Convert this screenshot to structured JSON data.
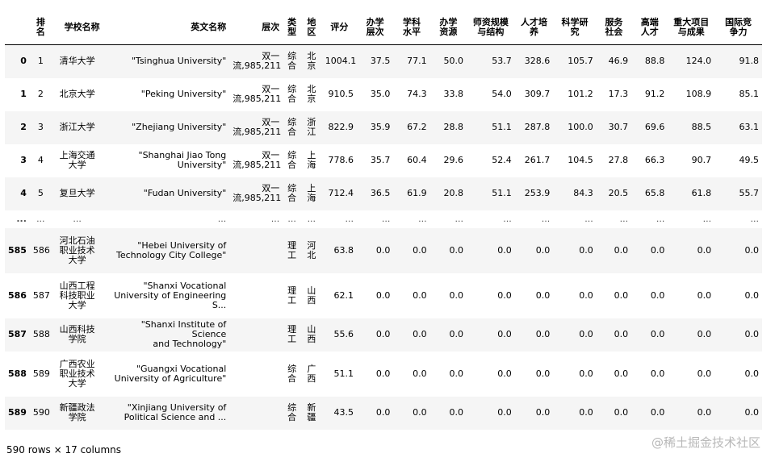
{
  "table": {
    "columns": [
      "",
      "排名",
      "学校名称",
      "英文名称",
      "层次",
      "类型",
      "地区",
      "评分",
      "办学层次",
      "学科水平",
      "办学资源",
      "师资规模与结构",
      "人才培养",
      "科学研究",
      "服务社会",
      "高端人才",
      "重大项目与成果",
      "国际竞争力"
    ],
    "column_labels": [
      "",
      "排\n名",
      "学校名称",
      "英文名称",
      "层次",
      "类\n型",
      "地\n区",
      "评分",
      "办学\n层次",
      "学科\n水平",
      "办学\n资源",
      "师资规模\n与结构",
      "人才培\n养",
      "科学研\n究",
      "服务\n社会",
      "高端\n人才",
      "重大项目\n与成果",
      "国际竞\n争力"
    ],
    "rows": [
      {
        "index": "0",
        "cells": [
          "1",
          "清华大学",
          "\"Tsinghua University\"",
          "双一\n流,985,211",
          "综\n合",
          "北\n京",
          "1004.1",
          "37.5",
          "77.1",
          "50.0",
          "53.7",
          "328.6",
          "105.7",
          "46.9",
          "88.8",
          "124.0",
          "91.8"
        ]
      },
      {
        "index": "1",
        "cells": [
          "2",
          "北京大学",
          "\"Peking University\"",
          "双一\n流,985,211",
          "综\n合",
          "北\n京",
          "910.5",
          "35.0",
          "74.3",
          "33.8",
          "54.0",
          "309.7",
          "101.2",
          "17.3",
          "91.2",
          "108.9",
          "85.1"
        ]
      },
      {
        "index": "2",
        "cells": [
          "3",
          "浙江大学",
          "\"Zhejiang University\"",
          "双一\n流,985,211",
          "综\n合",
          "浙\n江",
          "822.9",
          "35.9",
          "67.2",
          "28.8",
          "51.1",
          "287.8",
          "100.0",
          "30.7",
          "69.6",
          "88.5",
          "63.1"
        ]
      },
      {
        "index": "3",
        "cells": [
          "4",
          "上海交通\n大学",
          "\"Shanghai Jiao Tong\nUniversity\"",
          "双一\n流,985,211",
          "综\n合",
          "上\n海",
          "778.6",
          "35.7",
          "60.4",
          "29.6",
          "52.4",
          "261.7",
          "104.5",
          "27.8",
          "66.3",
          "90.7",
          "49.5"
        ]
      },
      {
        "index": "4",
        "cells": [
          "5",
          "复旦大学",
          "\"Fudan University\"",
          "双一\n流,985,211",
          "综\n合",
          "上\n海",
          "712.4",
          "36.5",
          "61.9",
          "20.8",
          "51.1",
          "253.9",
          "84.3",
          "20.5",
          "65.8",
          "61.8",
          "55.7"
        ]
      },
      {
        "index": "...",
        "ellipsis": true,
        "cells": [
          "...",
          "...",
          "...",
          "...",
          "...",
          "...",
          "...",
          "...",
          "...",
          "...",
          "...",
          "...",
          "...",
          "...",
          "...",
          "...",
          "..."
        ]
      },
      {
        "index": "585",
        "cells": [
          "586",
          "河北石油\n职业技术\n大学",
          "\"Hebei University of\nTechnology City College\"",
          "",
          "理\n工",
          "河\n北",
          "63.8",
          "0.0",
          "0.0",
          "0.0",
          "0.0",
          "0.0",
          "0.0",
          "0.0",
          "0.0",
          "0.0",
          "0.0"
        ]
      },
      {
        "index": "586",
        "cells": [
          "587",
          "山西工程\n科技职业\n大学",
          "\"Shanxi Vocational\nUniversity of Engineering\nS...",
          "",
          "理\n工",
          "山\n西",
          "62.1",
          "0.0",
          "0.0",
          "0.0",
          "0.0",
          "0.0",
          "0.0",
          "0.0",
          "0.0",
          "0.0",
          "0.0"
        ]
      },
      {
        "index": "587",
        "cells": [
          "588",
          "山西科技\n学院",
          "\"Shanxi Institute of Science\nand Technology\"",
          "",
          "理\n工",
          "山\n西",
          "55.6",
          "0.0",
          "0.0",
          "0.0",
          "0.0",
          "0.0",
          "0.0",
          "0.0",
          "0.0",
          "0.0",
          "0.0"
        ]
      },
      {
        "index": "588",
        "cells": [
          "589",
          "广西农业\n职业技术\n大学",
          "\"Guangxi Vocational\nUniversity of Agriculture\"",
          "",
          "综\n合",
          "广\n西",
          "51.1",
          "0.0",
          "0.0",
          "0.0",
          "0.0",
          "0.0",
          "0.0",
          "0.0",
          "0.0",
          "0.0",
          "0.0"
        ]
      },
      {
        "index": "589",
        "cells": [
          "590",
          "新疆政法\n学院",
          "\"Xinjiang University of\nPolitical Science and ...",
          "",
          "综\n合",
          "新\n疆",
          "43.5",
          "0.0",
          "0.0",
          "0.0",
          "0.0",
          "0.0",
          "0.0",
          "0.0",
          "0.0",
          "0.0",
          "0.0"
        ]
      }
    ]
  },
  "footer": "590 rows × 17 columns",
  "watermark": "@稀土掘金技术社区"
}
